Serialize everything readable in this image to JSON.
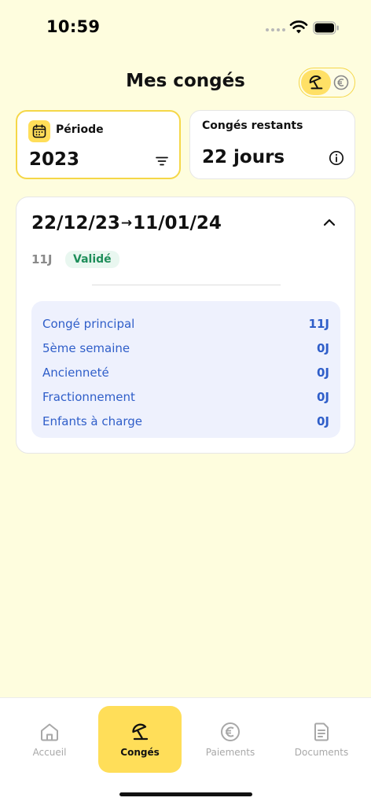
{
  "status_bar": {
    "time": "10:59"
  },
  "header": {
    "title": "Mes congés"
  },
  "periode": {
    "label": "Période",
    "value": "2023"
  },
  "restants": {
    "label": "Congés restants",
    "value": "22 jours"
  },
  "leave": {
    "start": "22/12/23",
    "arrow": "→",
    "end": "11/01/24",
    "duration": "11J",
    "status": "Validé",
    "breakdown": [
      {
        "label": "Congé principal",
        "value": "11J"
      },
      {
        "label": "5ème semaine",
        "value": "0J"
      },
      {
        "label": "Ancienneté",
        "value": "0J"
      },
      {
        "label": "Fractionnement",
        "value": "0J"
      },
      {
        "label": "Enfants à charge",
        "value": "0J"
      }
    ]
  },
  "nav": {
    "items": [
      {
        "label": "Accueil",
        "icon": "home-icon"
      },
      {
        "label": "Congés",
        "icon": "beach-umbrella-icon"
      },
      {
        "label": "Paiements",
        "icon": "euro-icon"
      },
      {
        "label": "Documents",
        "icon": "document-icon"
      }
    ],
    "active": "Congés"
  },
  "colors": {
    "background": "#FEFDDE",
    "accent": "#FFDE59",
    "accent_border": "#F5D748",
    "breakdown_bg": "#EEF1FD",
    "breakdown_text": "#2F5EC9",
    "badge_bg": "#E9F7F0",
    "badge_text": "#1E8E5A"
  }
}
